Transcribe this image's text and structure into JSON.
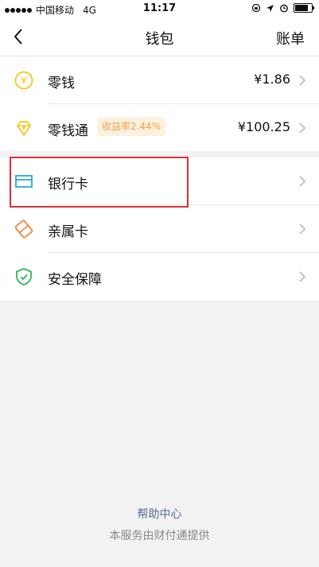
{
  "status_bar": {
    "carrier": "中国移动",
    "network": "4G",
    "time": "11:17"
  },
  "nav": {
    "title": "钱包",
    "bill_label": "账单"
  },
  "wallet": {
    "change": {
      "label": "零钱",
      "value": "¥1.86",
      "icon": "yen-coin-icon"
    },
    "licaitong": {
      "label": "零钱通",
      "badge": "收益率2.44%",
      "value": "¥100.25",
      "icon": "diamond-icon"
    }
  },
  "services": {
    "bank_card": {
      "label": "银行卡",
      "icon": "card-icon"
    },
    "family_card": {
      "label": "亲属卡",
      "icon": "family-card-icon"
    },
    "security": {
      "label": "安全保障",
      "icon": "shield-icon"
    }
  },
  "footer": {
    "help": "帮助中心",
    "note": "本服务由财付通提供"
  },
  "colors": {
    "accent_yellow": "#f5c518",
    "card_blue": "#2ba6e0",
    "family_orange": "#f0883c",
    "shield_green": "#2ab55a",
    "highlight_red": "#d9303a",
    "badge_text": "#f2a04a"
  }
}
